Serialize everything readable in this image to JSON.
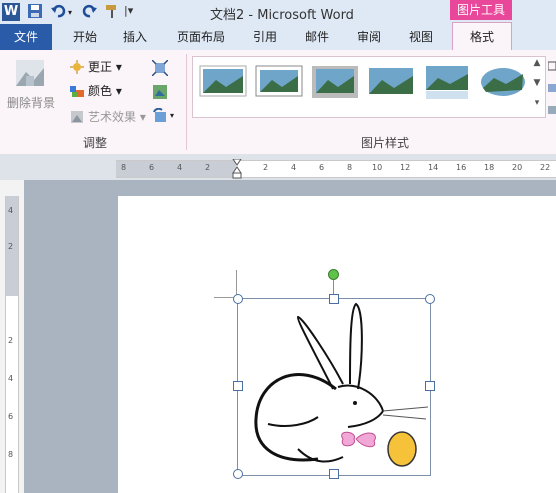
{
  "titlebar": {
    "title": "文档2  -  Microsoft Word",
    "context_tab": "图片工具",
    "word_icon": "W"
  },
  "tabs": [
    "开始",
    "插入",
    "页面布局",
    "引用",
    "邮件",
    "审阅",
    "视图"
  ],
  "file_tab": "文件",
  "format_tab": "格式",
  "ribbon": {
    "adjust": {
      "remove_bg": "删除背景",
      "corrections": "更正",
      "color": "颜色",
      "artistic": "艺术效果",
      "group_label": "调整"
    },
    "styles": {
      "group_label": "图片样式"
    }
  },
  "ruler_h": [
    "8",
    "6",
    "4",
    "2",
    "2",
    "4",
    "6",
    "8",
    "10",
    "12",
    "14",
    "16",
    "18",
    "20",
    "22"
  ],
  "ruler_v": [
    "4",
    "2",
    "2",
    "4",
    "6",
    "8"
  ],
  "colors": {
    "accent": "#e8479a",
    "file_tab": "#2a5ba8",
    "ribbon_bg": "#fbf4f8"
  }
}
